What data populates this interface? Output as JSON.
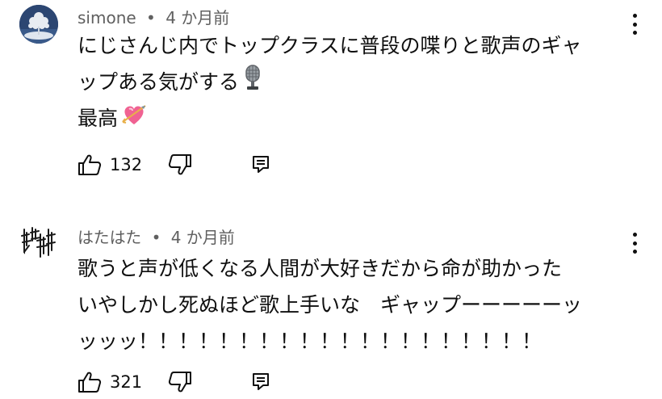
{
  "comments": [
    {
      "author": "simone",
      "separator": "•",
      "time": "4 か月前",
      "lines": [
        "にじさんじ内でトップクラスに普段の喋りと歌声のギャ",
        "ップある気がする",
        "最高"
      ],
      "emojis": [
        "microphone-emoji",
        "heart-with-arrow-emoji"
      ],
      "likes": "132",
      "icons": {
        "like": "thumbs-up-icon",
        "dislike": "thumbs-down-icon",
        "reply": "reply-icon",
        "menu": "more-vertical-icon"
      }
    },
    {
      "author": "はたはた",
      "separator": "•",
      "time": "4 か月前",
      "lines": [
        "歌うと声が低くなる人間が大好きだから命が助かった",
        "いやしかし死ぬほど歌上手いな　ギャップーーーーーッ",
        "ッッッ！！！！！！！！！！！！！！！！！！！！"
      ],
      "likes": "321",
      "icons": {
        "like": "thumbs-up-icon",
        "dislike": "thumbs-down-icon",
        "reply": "reply-icon",
        "menu": "more-vertical-icon"
      }
    }
  ],
  "colors": {
    "text": "#0f0f0f",
    "meta": "#606060",
    "background": "#ffffff"
  }
}
